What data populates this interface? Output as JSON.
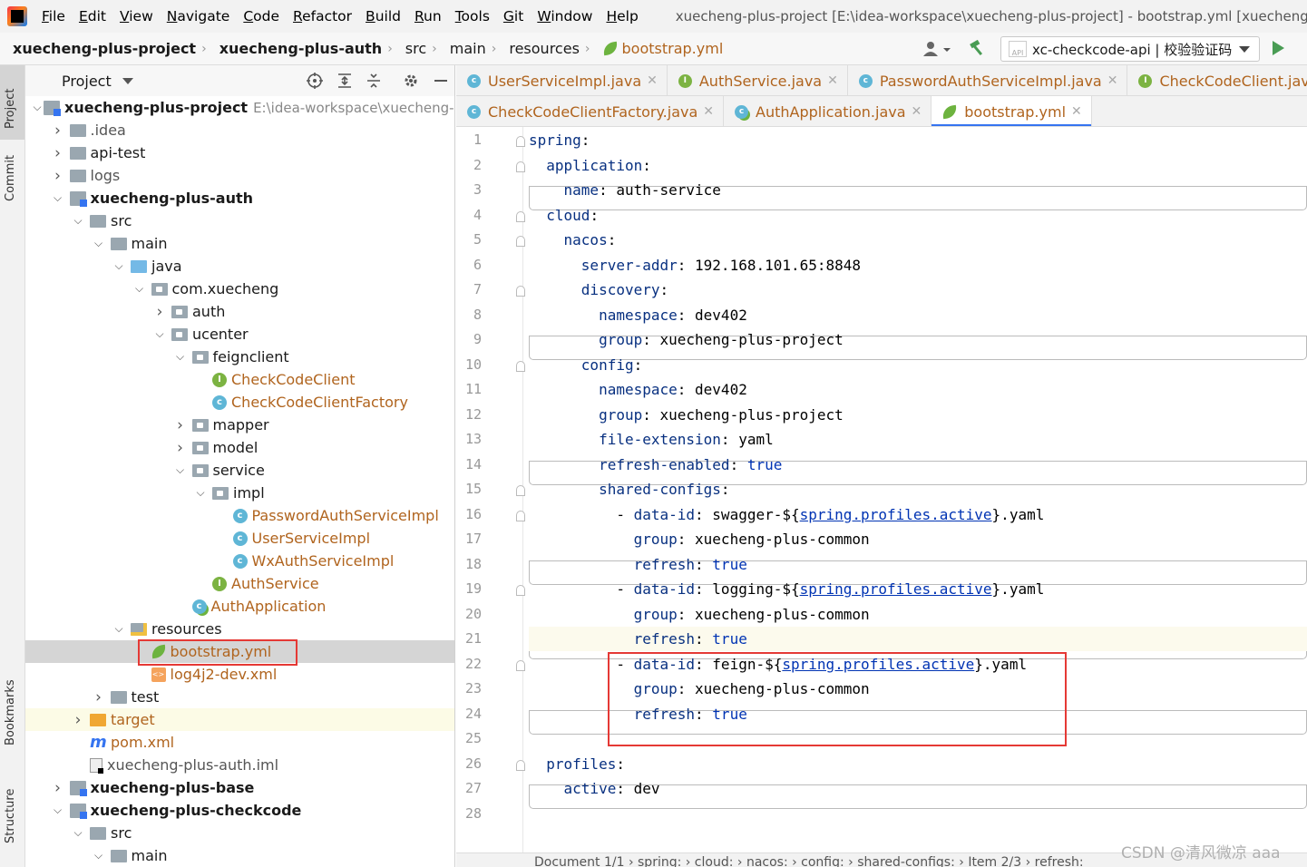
{
  "menu": {
    "items": [
      "File",
      "Edit",
      "View",
      "Navigate",
      "Code",
      "Refactor",
      "Build",
      "Run",
      "Tools",
      "Git",
      "Window",
      "Help"
    ],
    "window_title": "xuecheng-plus-project [E:\\idea-workspace\\xuecheng-plus-project] - bootstrap.yml [xuecheng-p"
  },
  "breadcrumb": [
    "xuecheng-plus-project",
    "xuecheng-plus-auth",
    "src",
    "main",
    "resources",
    "bootstrap.yml"
  ],
  "run_config": {
    "label": "xc-checkcode-api | 校验验证码"
  },
  "sidebar_tabs": {
    "project": "Project",
    "commit": "Commit",
    "bookmarks": "Bookmarks",
    "structure": "Structure"
  },
  "project_panel": {
    "title": "Project",
    "root_path": "E:\\idea-workspace\\xuecheng-plu",
    "tree": [
      {
        "label": "xuecheng-plus-project",
        "depth": 0,
        "arrow": "open",
        "icon": "module",
        "style": "bold"
      },
      {
        "label": ".idea",
        "depth": 1,
        "arrow": "closed",
        "icon": "folder",
        "style": "dim"
      },
      {
        "label": "api-test",
        "depth": 1,
        "arrow": "closed",
        "icon": "folder",
        "style": ""
      },
      {
        "label": "logs",
        "depth": 1,
        "arrow": "closed",
        "icon": "folder",
        "style": "dim"
      },
      {
        "label": "xuecheng-plus-auth",
        "depth": 1,
        "arrow": "open",
        "icon": "module",
        "style": "bold"
      },
      {
        "label": "src",
        "depth": 2,
        "arrow": "open",
        "icon": "folder",
        "style": ""
      },
      {
        "label": "main",
        "depth": 3,
        "arrow": "open",
        "icon": "folder",
        "style": ""
      },
      {
        "label": "java",
        "depth": 4,
        "arrow": "open",
        "icon": "folder-blue",
        "style": ""
      },
      {
        "label": "com.xuecheng",
        "depth": 5,
        "arrow": "open",
        "icon": "package",
        "style": ""
      },
      {
        "label": "auth",
        "depth": 6,
        "arrow": "closed",
        "icon": "package",
        "style": ""
      },
      {
        "label": "ucenter",
        "depth": 6,
        "arrow": "open",
        "icon": "package",
        "style": ""
      },
      {
        "label": "feignclient",
        "depth": 7,
        "arrow": "open",
        "icon": "package",
        "style": ""
      },
      {
        "label": "CheckCodeClient",
        "depth": 8,
        "arrow": "",
        "icon": "interface",
        "style": "org"
      },
      {
        "label": "CheckCodeClientFactory",
        "depth": 8,
        "arrow": "",
        "icon": "class",
        "style": "org"
      },
      {
        "label": "mapper",
        "depth": 7,
        "arrow": "closed",
        "icon": "package",
        "style": ""
      },
      {
        "label": "model",
        "depth": 7,
        "arrow": "closed",
        "icon": "package",
        "style": ""
      },
      {
        "label": "service",
        "depth": 7,
        "arrow": "open",
        "icon": "package",
        "style": ""
      },
      {
        "label": "impl",
        "depth": 8,
        "arrow": "open",
        "icon": "package",
        "style": ""
      },
      {
        "label": "PasswordAuthServiceImpl",
        "depth": 9,
        "arrow": "",
        "icon": "class",
        "style": "org"
      },
      {
        "label": "UserServiceImpl",
        "depth": 9,
        "arrow": "",
        "icon": "class",
        "style": "org"
      },
      {
        "label": "WxAuthServiceImpl",
        "depth": 9,
        "arrow": "",
        "icon": "class",
        "style": "org"
      },
      {
        "label": "AuthService",
        "depth": 8,
        "arrow": "",
        "icon": "interface",
        "style": "org"
      },
      {
        "label": "AuthApplication",
        "depth": 7,
        "arrow": "",
        "icon": "app",
        "style": "org"
      },
      {
        "label": "resources",
        "depth": 4,
        "arrow": "open",
        "icon": "folder-res",
        "style": ""
      },
      {
        "label": "bootstrap.yml",
        "depth": 5,
        "arrow": "",
        "icon": "yml",
        "style": "org",
        "selected": true
      },
      {
        "label": "log4j2-dev.xml",
        "depth": 5,
        "arrow": "",
        "icon": "xml",
        "style": "org"
      },
      {
        "label": "test",
        "depth": 3,
        "arrow": "closed",
        "icon": "folder",
        "style": ""
      },
      {
        "label": "target",
        "depth": 2,
        "arrow": "closed",
        "icon": "folder-orange",
        "style": "org",
        "yellow": true
      },
      {
        "label": "pom.xml",
        "depth": 2,
        "arrow": "",
        "icon": "maven",
        "style": "org"
      },
      {
        "label": "xuecheng-plus-auth.iml",
        "depth": 2,
        "arrow": "",
        "icon": "iml",
        "style": "dim"
      },
      {
        "label": "xuecheng-plus-base",
        "depth": 1,
        "arrow": "closed",
        "icon": "module",
        "style": "bold"
      },
      {
        "label": "xuecheng-plus-checkcode",
        "depth": 1,
        "arrow": "open",
        "icon": "module",
        "style": "bold"
      },
      {
        "label": "src",
        "depth": 2,
        "arrow": "open",
        "icon": "folder",
        "style": ""
      },
      {
        "label": "main",
        "depth": 3,
        "arrow": "open",
        "icon": "folder",
        "style": ""
      }
    ]
  },
  "editor_tabs_row1": [
    {
      "label": "UserServiceImpl.java",
      "icon": "class"
    },
    {
      "label": "AuthService.java",
      "icon": "interface"
    },
    {
      "label": "PasswordAuthServiceImpl.java",
      "icon": "class"
    },
    {
      "label": "CheckCodeClient.java",
      "icon": "interface"
    },
    {
      "label": "C",
      "icon": "class"
    }
  ],
  "editor_tabs_row2": [
    {
      "label": "CheckCodeClientFactory.java",
      "icon": "class"
    },
    {
      "label": "AuthApplication.java",
      "icon": "app"
    },
    {
      "label": "bootstrap.yml",
      "icon": "yml",
      "active": true
    }
  ],
  "code_lines": [
    [
      [
        "k",
        "spring"
      ],
      [
        "v",
        ":"
      ]
    ],
    [
      [
        "v",
        "  "
      ],
      [
        "k",
        "application"
      ],
      [
        "v",
        ":"
      ]
    ],
    [
      [
        "v",
        "    "
      ],
      [
        "k",
        "name"
      ],
      [
        "v",
        ": auth-service"
      ]
    ],
    [
      [
        "v",
        "  "
      ],
      [
        "k",
        "cloud"
      ],
      [
        "v",
        ":"
      ]
    ],
    [
      [
        "v",
        "    "
      ],
      [
        "k",
        "nacos"
      ],
      [
        "v",
        ":"
      ]
    ],
    [
      [
        "v",
        "      "
      ],
      [
        "k",
        "server-addr"
      ],
      [
        "v",
        ": 192.168.101.65:8848"
      ]
    ],
    [
      [
        "v",
        "      "
      ],
      [
        "k",
        "discovery"
      ],
      [
        "v",
        ":"
      ]
    ],
    [
      [
        "v",
        "        "
      ],
      [
        "k",
        "namespace"
      ],
      [
        "v",
        ": dev402"
      ]
    ],
    [
      [
        "v",
        "        "
      ],
      [
        "k",
        "group"
      ],
      [
        "v",
        ": xuecheng-plus-project"
      ]
    ],
    [
      [
        "v",
        "      "
      ],
      [
        "k",
        "config"
      ],
      [
        "v",
        ":"
      ]
    ],
    [
      [
        "v",
        "        "
      ],
      [
        "k",
        "namespace"
      ],
      [
        "v",
        ": dev402"
      ]
    ],
    [
      [
        "v",
        "        "
      ],
      [
        "k",
        "group"
      ],
      [
        "v",
        ": xuecheng-plus-project"
      ]
    ],
    [
      [
        "v",
        "        "
      ],
      [
        "k",
        "file-extension"
      ],
      [
        "v",
        ": yaml"
      ]
    ],
    [
      [
        "v",
        "        "
      ],
      [
        "k",
        "refresh-enabled"
      ],
      [
        "v",
        ": "
      ],
      [
        "tr",
        "true"
      ]
    ],
    [
      [
        "v",
        "        "
      ],
      [
        "k",
        "shared-configs"
      ],
      [
        "v",
        ":"
      ]
    ],
    [
      [
        "v",
        "          - "
      ],
      [
        "k",
        "data-id"
      ],
      [
        "v",
        ": swagger-${"
      ],
      [
        "ref",
        "spring.profiles.active"
      ],
      [
        "v",
        "}.yaml"
      ]
    ],
    [
      [
        "v",
        "            "
      ],
      [
        "k",
        "group"
      ],
      [
        "v",
        ": xuecheng-plus-common"
      ]
    ],
    [
      [
        "v",
        "            "
      ],
      [
        "k",
        "refresh"
      ],
      [
        "v",
        ": "
      ],
      [
        "tr",
        "true"
      ]
    ],
    [
      [
        "v",
        "          - "
      ],
      [
        "k",
        "data-id"
      ],
      [
        "v",
        ": logging-${"
      ],
      [
        "ref",
        "spring.profiles.active"
      ],
      [
        "v",
        "}.yaml"
      ]
    ],
    [
      [
        "v",
        "            "
      ],
      [
        "k",
        "group"
      ],
      [
        "v",
        ": xuecheng-plus-common"
      ]
    ],
    [
      [
        "v",
        "            "
      ],
      [
        "k",
        "refresh"
      ],
      [
        "v",
        ": "
      ],
      [
        "tr",
        "true"
      ]
    ],
    [
      [
        "v",
        "          - "
      ],
      [
        "k",
        "data-id"
      ],
      [
        "v",
        ": feign-${"
      ],
      [
        "ref",
        "spring.profiles.active"
      ],
      [
        "v",
        "}.yaml"
      ]
    ],
    [
      [
        "v",
        "            "
      ],
      [
        "k",
        "group"
      ],
      [
        "v",
        ": xuecheng-plus-common"
      ]
    ],
    [
      [
        "v",
        "            "
      ],
      [
        "k",
        "refresh"
      ],
      [
        "v",
        ": "
      ],
      [
        "tr",
        "true"
      ]
    ],
    [
      [
        "v",
        ""
      ]
    ],
    [
      [
        "v",
        "  "
      ],
      [
        "k",
        "profiles"
      ],
      [
        "v",
        ":"
      ]
    ],
    [
      [
        "v",
        "    "
      ],
      [
        "k",
        "active"
      ],
      [
        "v",
        ": dev"
      ]
    ],
    [
      [
        "v",
        ""
      ]
    ]
  ],
  "status_bar": "Document 1/1  ›  spring:  ›  cloud:  ›  nacos:  ›  config:  ›  shared-configs:  ›  Item 2/3  ›  refresh:",
  "watermark": "CSDN @清风微凉 aaa"
}
